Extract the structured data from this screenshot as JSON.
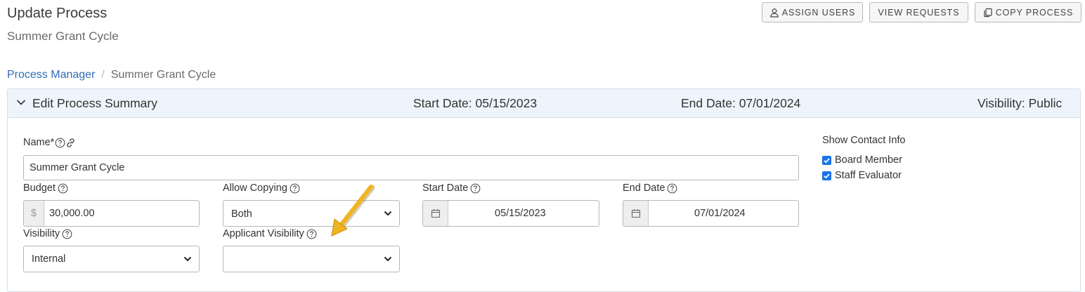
{
  "header": {
    "title": "Update Process",
    "subtitle": "Summer Grant Cycle",
    "buttons": {
      "assign_users": "ASSIGN USERS",
      "view_requests": "VIEW REQUESTS",
      "copy_process": "COPY PROCESS"
    }
  },
  "breadcrumb": {
    "link": "Process Manager",
    "separator": "/",
    "current": "Summer Grant Cycle"
  },
  "summary": {
    "title": "Edit Process Summary",
    "start_date": "Start Date: 05/15/2023",
    "end_date": "End Date: 07/01/2024",
    "visibility": "Visibility: Public"
  },
  "form": {
    "name_label": "Name*",
    "name_value": "Summer Grant Cycle",
    "budget_label": "Budget",
    "budget_prefix": "$",
    "budget_value": "30,000.00",
    "allow_copying_label": "Allow Copying",
    "allow_copying_value": "Both",
    "start_date_label": "Start Date",
    "start_date_value": "05/15/2023",
    "end_date_label": "End Date",
    "end_date_value": "07/01/2024",
    "visibility_label": "Visibility",
    "visibility_value": "Internal",
    "applicant_visibility_label": "Applicant Visibility",
    "applicant_visibility_value": ""
  },
  "contact_info": {
    "title": "Show Contact Info",
    "options": [
      {
        "label": "Board Member",
        "checked": true
      },
      {
        "label": "Staff Evaluator",
        "checked": true
      }
    ]
  },
  "colors": {
    "link": "#2f6db5",
    "header_bg": "#eef4fb",
    "checkbox": "#1a73e8",
    "arrow": "#f2b320"
  },
  "icons": [
    "user-icon",
    "copy-icon",
    "chevron-down-icon",
    "help-icon",
    "link-icon",
    "calendar-icon",
    "check-icon",
    "annotation-arrow"
  ]
}
